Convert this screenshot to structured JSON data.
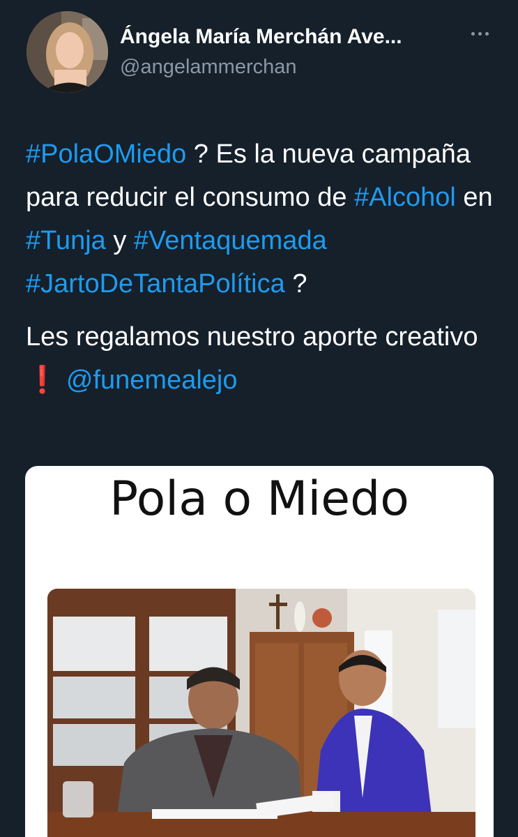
{
  "author": {
    "display_name": "Ángela María Merchán Ave...",
    "handle": "@angelammerchan"
  },
  "tweet": {
    "paragraph1": [
      {
        "type": "hashtag",
        "text": "#PolaOMiedo"
      },
      {
        "type": "text",
        "text": " ? Es la nueva campaña para reducir el consumo de "
      },
      {
        "type": "hashtag",
        "text": "#Alcohol"
      },
      {
        "type": "text",
        "text": " en "
      },
      {
        "type": "hashtag",
        "text": "#Tunja"
      },
      {
        "type": "text",
        "text": " y "
      },
      {
        "type": "hashtag",
        "text": "#Ventaquemada"
      },
      {
        "type": "text",
        "text": " "
      },
      {
        "type": "hashtag",
        "text": "#JartoDeTantaPolítica"
      },
      {
        "type": "text",
        "text": " ?"
      }
    ],
    "paragraph2": [
      {
        "type": "text",
        "text": "Les regalamos nuestro aporte creativo "
      },
      {
        "type": "emoji",
        "text": "❗"
      },
      {
        "type": "text",
        "text": " "
      },
      {
        "type": "mention",
        "text": "@funemealejo"
      }
    ]
  },
  "media": {
    "title": "Pola o Miedo",
    "photo_icon": "photo-of-two-men-at-desk"
  },
  "colors": {
    "background": "#15202b",
    "link": "#1d9bf0",
    "secondary_text": "#8b98a5"
  }
}
